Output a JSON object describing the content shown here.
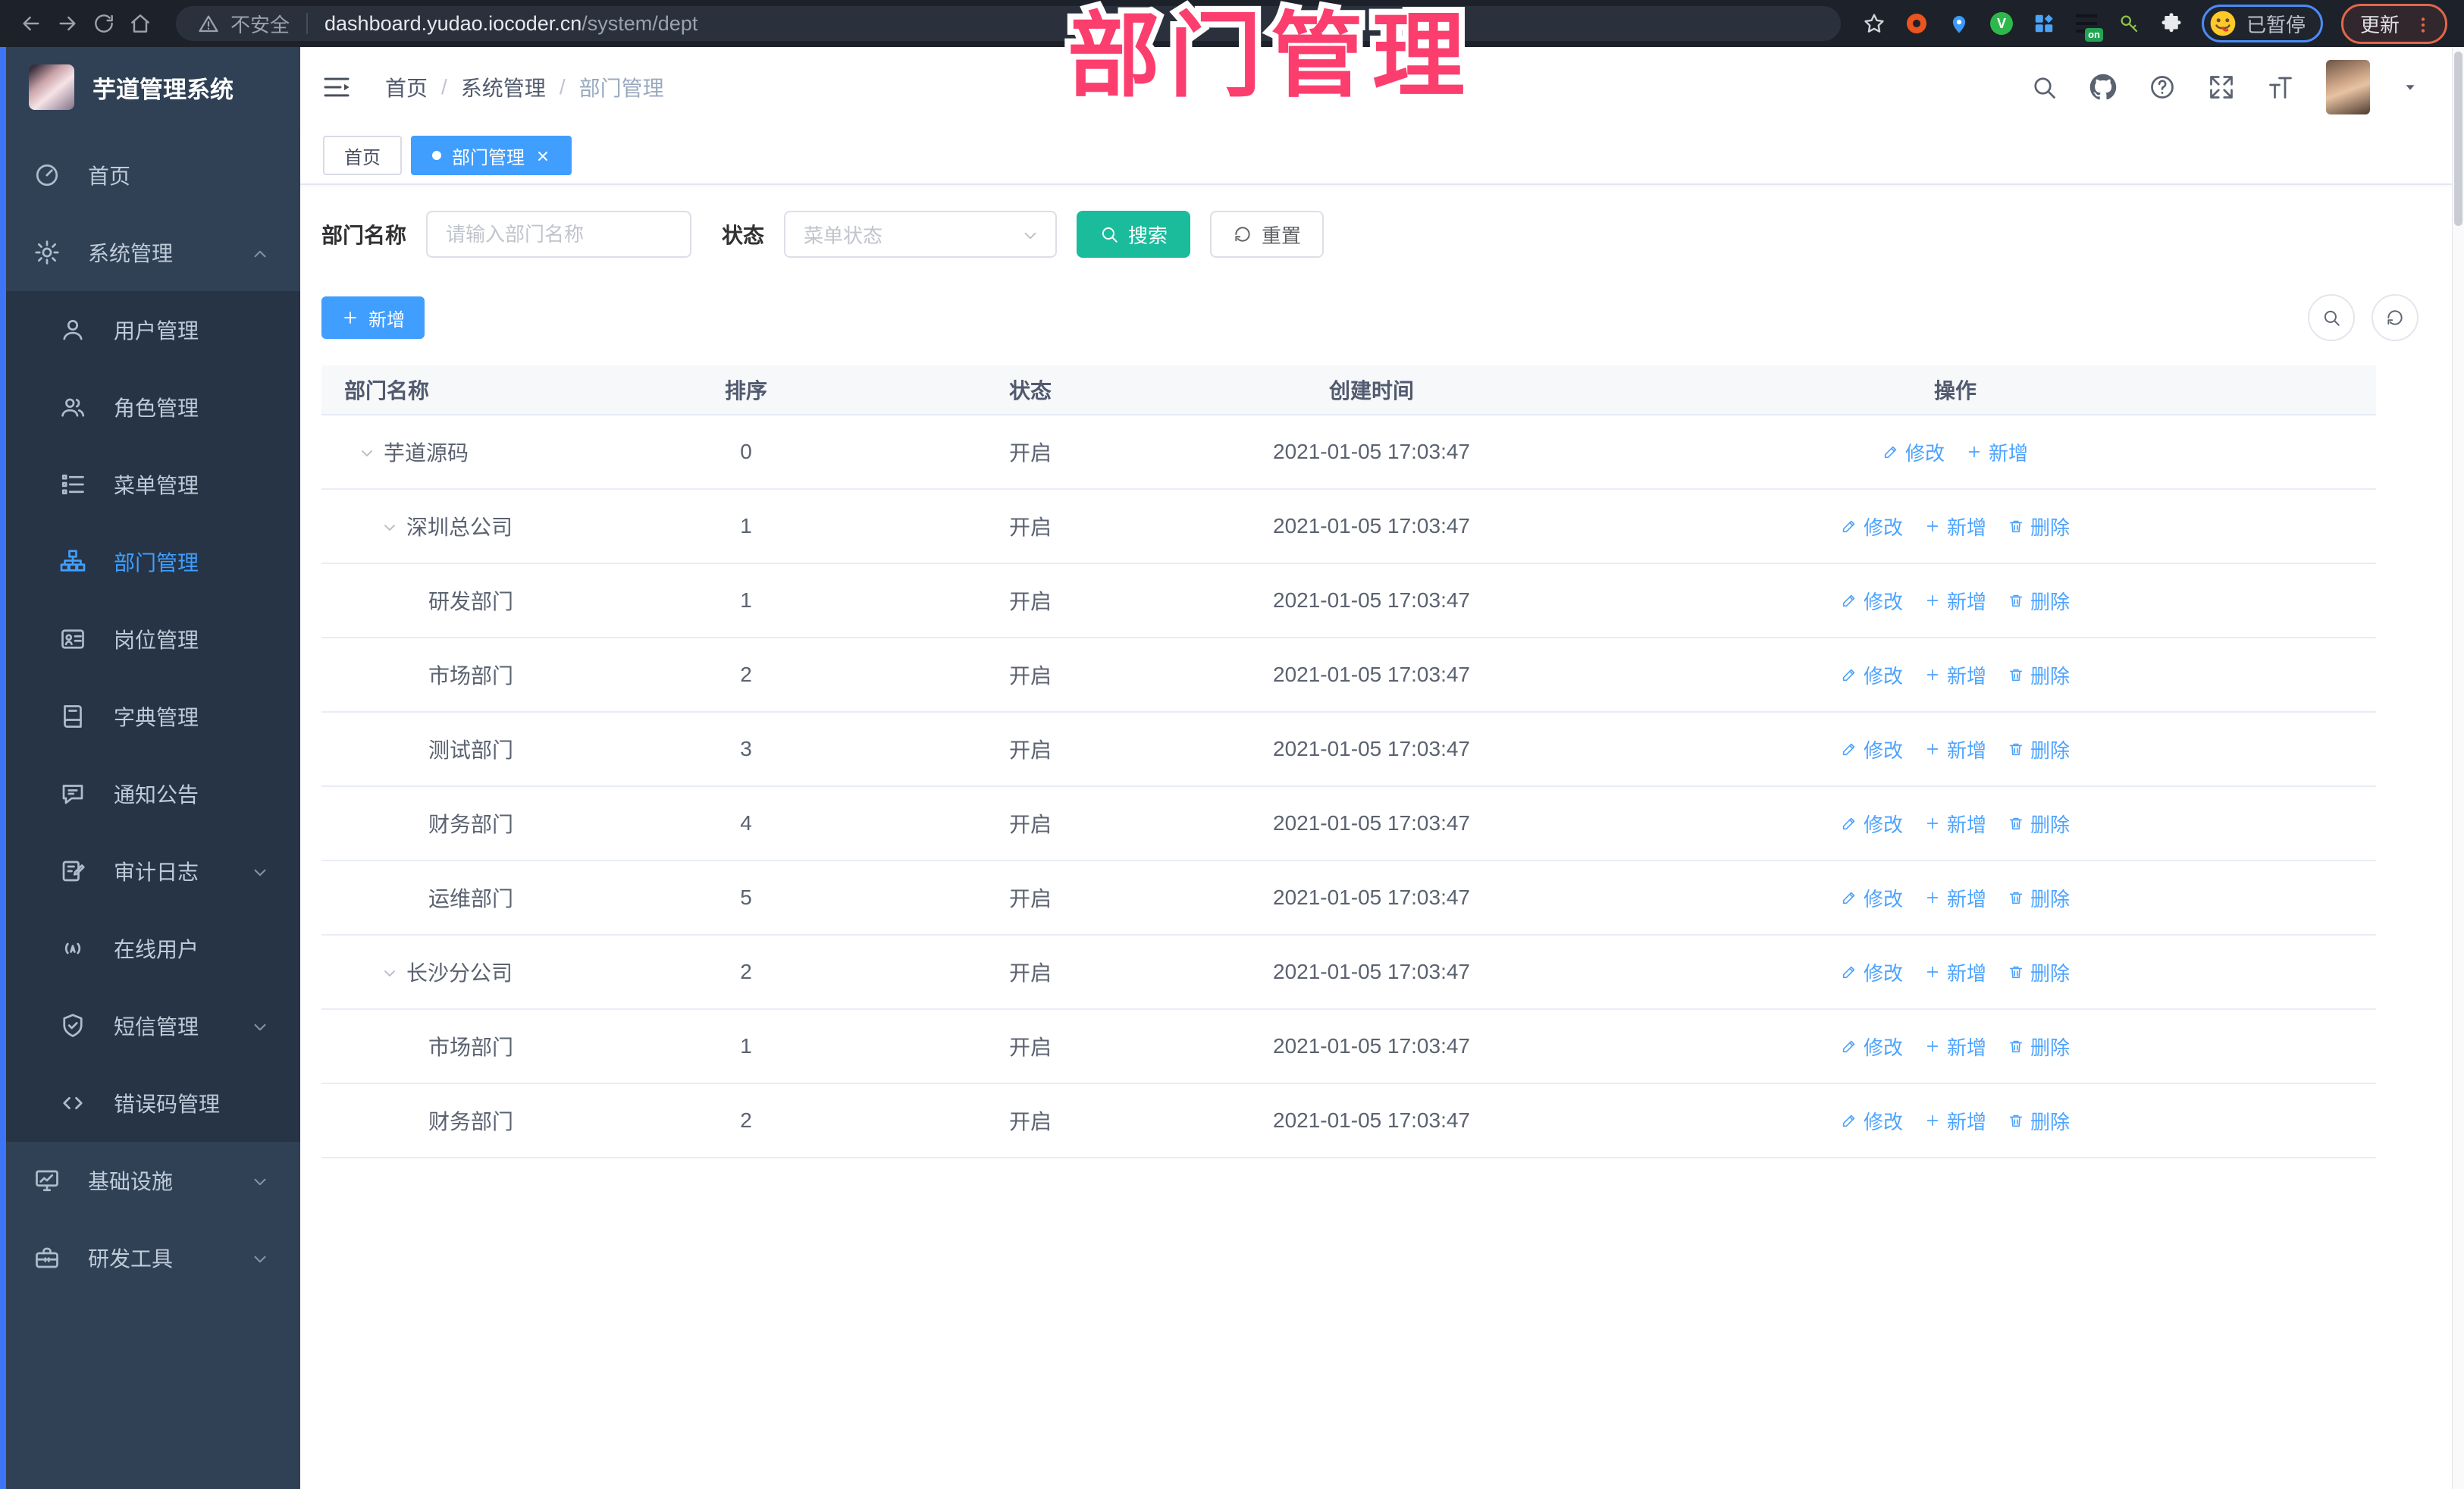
{
  "watermark_text": "部门管理",
  "colors": {
    "primary": "#409EFF",
    "search_teal": "#1ABC9C",
    "watermark_pink": "#FB3E6E",
    "sidebar_bg": "#304156",
    "submenu_bg": "#263445",
    "accent_strip": "#3E74F6",
    "update_orange": "#E2664C",
    "paused_blue": "#4B8BF5"
  },
  "browser": {
    "security_label": "不安全",
    "url_domain": "dashboard.yudao.iocoder.cn",
    "url_path": "/system/dept",
    "paused_badge_label": "已暂停",
    "update_button_label": "更新",
    "extensions": [
      {
        "name": "ubuntu-ext-icon",
        "style": "ring",
        "color": "#E95420"
      },
      {
        "name": "location-pin-ext-icon",
        "style": "pin",
        "color": "#3B99FC"
      },
      {
        "name": "v-badge-ext-icon",
        "style": "circle-letter",
        "letter": "V",
        "color": "#2DB84C"
      },
      {
        "name": "grid-ext-icon",
        "style": "grid",
        "color": "#4AA3F5"
      },
      {
        "name": "list-on-ext-icon",
        "style": "list-on",
        "badge": "on",
        "color": "#23a455"
      },
      {
        "name": "key-ext-icon",
        "style": "key",
        "color": "#8BC34A"
      },
      {
        "name": "puzzle-ext-icon",
        "style": "puzzle",
        "color": "#E8EAED"
      }
    ]
  },
  "sidebar": {
    "title": "芋道管理系统",
    "items": [
      {
        "label": "首页",
        "icon": "dashboard-icon",
        "type": "top",
        "caret": "",
        "active": false
      },
      {
        "label": "系统管理",
        "icon": "gear-icon",
        "type": "top",
        "caret": "up",
        "active": false
      },
      {
        "label": "用户管理",
        "icon": "user-icon",
        "type": "sub",
        "caret": "",
        "active": false
      },
      {
        "label": "角色管理",
        "icon": "users-icon",
        "type": "sub",
        "caret": "",
        "active": false
      },
      {
        "label": "菜单管理",
        "icon": "menu-list-icon",
        "type": "sub",
        "caret": "",
        "active": false
      },
      {
        "label": "部门管理",
        "icon": "org-tree-icon",
        "type": "sub",
        "caret": "",
        "active": true
      },
      {
        "label": "岗位管理",
        "icon": "id-card-icon",
        "type": "sub",
        "caret": "",
        "active": false
      },
      {
        "label": "字典管理",
        "icon": "book-icon",
        "type": "sub",
        "caret": "",
        "active": false
      },
      {
        "label": "通知公告",
        "icon": "megaphone-icon",
        "type": "sub",
        "caret": "",
        "active": false
      },
      {
        "label": "审计日志",
        "icon": "audit-log-icon",
        "type": "sub",
        "caret": "down",
        "active": false
      },
      {
        "label": "在线用户",
        "icon": "online-user-icon",
        "type": "sub",
        "caret": "",
        "active": false
      },
      {
        "label": "短信管理",
        "icon": "sms-shield-icon",
        "type": "sub",
        "caret": "down",
        "active": false
      },
      {
        "label": "错误码管理",
        "icon": "code-icon",
        "type": "sub",
        "caret": "",
        "active": false
      },
      {
        "label": "基础设施",
        "icon": "monitor-icon",
        "type": "top",
        "caret": "down",
        "active": false
      },
      {
        "label": "研发工具",
        "icon": "toolbox-icon",
        "type": "top",
        "caret": "down",
        "active": false
      }
    ]
  },
  "header": {
    "breadcrumb": [
      "首页",
      "系统管理",
      "部门管理"
    ],
    "breadcrumb_separator": "/"
  },
  "tabs": [
    {
      "label": "首页",
      "active": false,
      "closable": false
    },
    {
      "label": "部门管理",
      "active": true,
      "closable": true
    }
  ],
  "filter": {
    "name_label": "部门名称",
    "name_placeholder": "请输入部门名称",
    "status_label": "状态",
    "status_placeholder": "菜单状态",
    "search_label": "搜索",
    "reset_label": "重置"
  },
  "toolbar": {
    "add_label": "新增"
  },
  "table": {
    "columns": [
      "部门名称",
      "排序",
      "状态",
      "创建时间",
      "操作"
    ],
    "rows": [
      {
        "name": "芋道源码",
        "level": 0,
        "expandable": true,
        "sort": "0",
        "status": "开启",
        "created": "2021-01-05 17:03:47",
        "actions": [
          {
            "label": "修改",
            "icon": "edit-icon"
          },
          {
            "label": "新增",
            "icon": "plus-icon"
          }
        ]
      },
      {
        "name": "深圳总公司",
        "level": 1,
        "expandable": true,
        "sort": "1",
        "status": "开启",
        "created": "2021-01-05 17:03:47",
        "actions": [
          {
            "label": "修改",
            "icon": "edit-icon"
          },
          {
            "label": "新增",
            "icon": "plus-icon"
          },
          {
            "label": "删除",
            "icon": "trash-icon"
          }
        ]
      },
      {
        "name": "研发部门",
        "level": 2,
        "expandable": false,
        "sort": "1",
        "status": "开启",
        "created": "2021-01-05 17:03:47",
        "actions": [
          {
            "label": "修改",
            "icon": "edit-icon"
          },
          {
            "label": "新增",
            "icon": "plus-icon"
          },
          {
            "label": "删除",
            "icon": "trash-icon"
          }
        ]
      },
      {
        "name": "市场部门",
        "level": 2,
        "expandable": false,
        "sort": "2",
        "status": "开启",
        "created": "2021-01-05 17:03:47",
        "actions": [
          {
            "label": "修改",
            "icon": "edit-icon"
          },
          {
            "label": "新增",
            "icon": "plus-icon"
          },
          {
            "label": "删除",
            "icon": "trash-icon"
          }
        ]
      },
      {
        "name": "测试部门",
        "level": 2,
        "expandable": false,
        "sort": "3",
        "status": "开启",
        "created": "2021-01-05 17:03:47",
        "actions": [
          {
            "label": "修改",
            "icon": "edit-icon"
          },
          {
            "label": "新增",
            "icon": "plus-icon"
          },
          {
            "label": "删除",
            "icon": "trash-icon"
          }
        ]
      },
      {
        "name": "财务部门",
        "level": 2,
        "expandable": false,
        "sort": "4",
        "status": "开启",
        "created": "2021-01-05 17:03:47",
        "actions": [
          {
            "label": "修改",
            "icon": "edit-icon"
          },
          {
            "label": "新增",
            "icon": "plus-icon"
          },
          {
            "label": "删除",
            "icon": "trash-icon"
          }
        ]
      },
      {
        "name": "运维部门",
        "level": 2,
        "expandable": false,
        "sort": "5",
        "status": "开启",
        "created": "2021-01-05 17:03:47",
        "actions": [
          {
            "label": "修改",
            "icon": "edit-icon"
          },
          {
            "label": "新增",
            "icon": "plus-icon"
          },
          {
            "label": "删除",
            "icon": "trash-icon"
          }
        ]
      },
      {
        "name": "长沙分公司",
        "level": 1,
        "expandable": true,
        "sort": "2",
        "status": "开启",
        "created": "2021-01-05 17:03:47",
        "actions": [
          {
            "label": "修改",
            "icon": "edit-icon"
          },
          {
            "label": "新增",
            "icon": "plus-icon"
          },
          {
            "label": "删除",
            "icon": "trash-icon"
          }
        ]
      },
      {
        "name": "市场部门",
        "level": 2,
        "expandable": false,
        "sort": "1",
        "status": "开启",
        "created": "2021-01-05 17:03:47",
        "actions": [
          {
            "label": "修改",
            "icon": "edit-icon"
          },
          {
            "label": "新增",
            "icon": "plus-icon"
          },
          {
            "label": "删除",
            "icon": "trash-icon"
          }
        ]
      },
      {
        "name": "财务部门",
        "level": 2,
        "expandable": false,
        "sort": "2",
        "status": "开启",
        "created": "2021-01-05 17:03:47",
        "actions": [
          {
            "label": "修改",
            "icon": "edit-icon"
          },
          {
            "label": "新增",
            "icon": "plus-icon"
          },
          {
            "label": "删除",
            "icon": "trash-icon"
          }
        ]
      }
    ]
  }
}
